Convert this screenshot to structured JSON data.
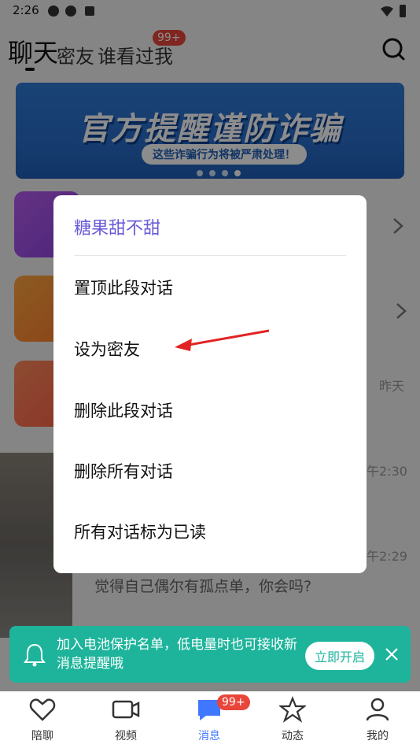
{
  "status_bar": {
    "time": "2:26"
  },
  "header": {
    "tabs": [
      {
        "label": "聊天",
        "active": true
      },
      {
        "label": "密友",
        "active": false
      },
      {
        "label": "谁看过我",
        "active": false,
        "badge": "99+"
      }
    ]
  },
  "banner": {
    "title": "官方提醒谨防诈骗",
    "subtitle": "这些诈骗行为将被严肃处理！"
  },
  "list": {
    "times": [
      "昨天",
      "午2:30",
      "午2:29"
    ],
    "preview": "觉得自己偶尔有孤点单，你会吗?"
  },
  "dialog": {
    "title": "糖果甜不甜",
    "items": [
      "置顶此段对话",
      "设为密友",
      "删除此段对话",
      "删除所有对话",
      "所有对话标为已读"
    ]
  },
  "notification": {
    "text": "加入电池保护名单，低电量时也可接收新消息提醒哦",
    "button": "立即开启"
  },
  "bottom_nav": {
    "items": [
      {
        "label": "陪聊"
      },
      {
        "label": "视频"
      },
      {
        "label": "消息",
        "badge": "99+"
      },
      {
        "label": "动态"
      },
      {
        "label": "我的"
      }
    ]
  },
  "colors": {
    "accent": "#6a5bd8",
    "notify_bg": "#1db49b",
    "badge": "#e9453b",
    "nav_active": "#3f78ff"
  }
}
